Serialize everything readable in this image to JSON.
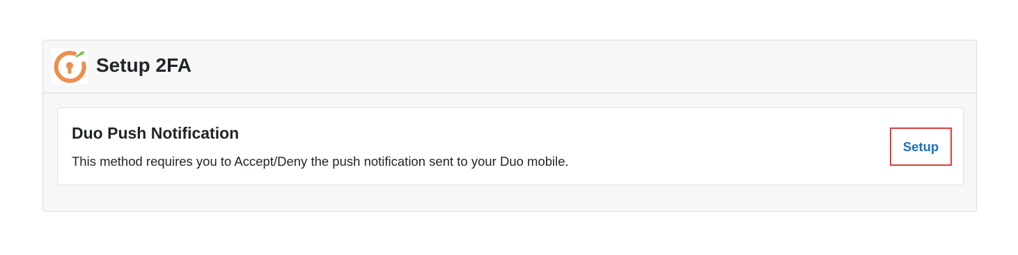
{
  "panel": {
    "logo_icon": "orange-lock-circle-icon",
    "title": "Setup 2FA"
  },
  "method": {
    "title": "Duo Push Notification",
    "description": "This method requires you to Accept/Deny the push notification sent to your Duo mobile.",
    "setup_label": "Setup"
  },
  "colors": {
    "accent_orange": "#ec8f4c",
    "accent_green": "#6fbf3f",
    "link_blue": "#1a6fc4",
    "highlight_red": "#e03c3c"
  }
}
